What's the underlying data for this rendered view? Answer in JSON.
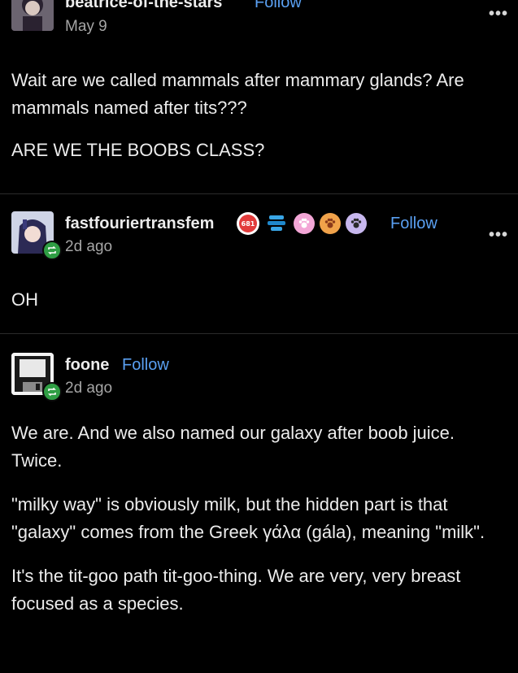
{
  "posts": [
    {
      "username": "beatrice-of-the-stars",
      "follow_label": "Follow",
      "date": "May 9",
      "paragraphs": [
        "Wait are we called mammals after mammary glands? Are mammals named after tits???",
        "ARE WE THE BOOBS CLASS?"
      ]
    },
    {
      "username": "fastfouriertransfem",
      "follow_label": "Follow",
      "date": "2d ago",
      "badge_text": "681",
      "paragraphs": [
        "OH"
      ]
    },
    {
      "username": "foone",
      "follow_label": "Follow",
      "date": "2d ago",
      "paragraphs": [
        "We are. And we also named our galaxy after boob juice. Twice.",
        "\"milky way\" is obviously milk, but the hidden part is that \"galaxy\" comes from the Greek γάλα (gála), meaning \"milk\".",
        "It's the tit-goo path tit-goo-thing. We are very, very breast focused as a species."
      ]
    }
  ],
  "more_label": "•••",
  "colors": {
    "background": "#000000",
    "text": "#ececec",
    "muted": "#a5a5a5",
    "follow": "#5aa0f2",
    "reblog": "#2f9e44"
  }
}
